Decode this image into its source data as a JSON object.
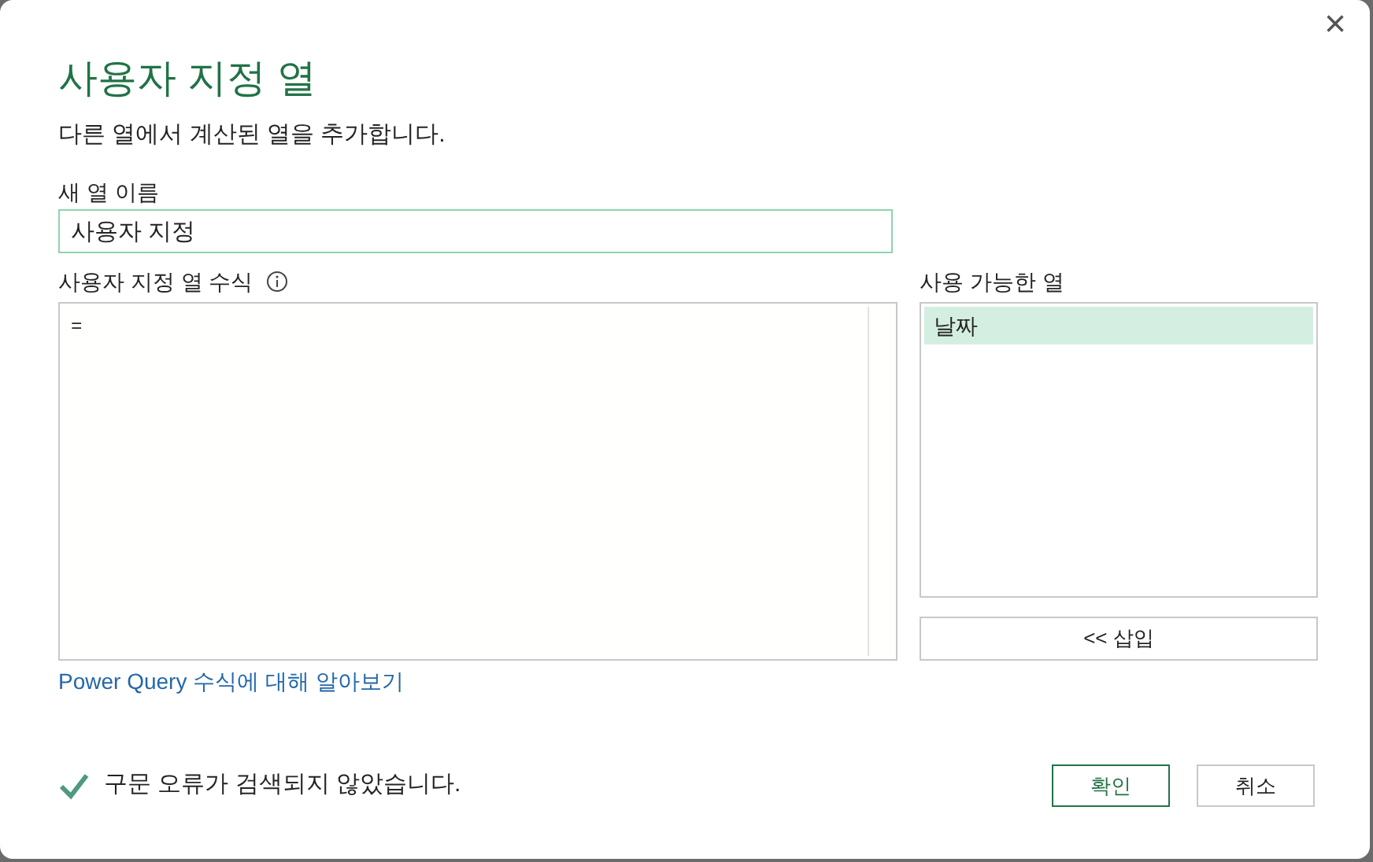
{
  "dialog": {
    "title": "사용자 지정 열",
    "subtitle": "다른 열에서 계산된 열을 추가합니다.",
    "close": "×"
  },
  "name_field": {
    "label": "새 열 이름",
    "value": "사용자 지정"
  },
  "formula": {
    "label": "사용자 지정 열 수식",
    "value": "="
  },
  "available_columns": {
    "label": "사용 가능한 열",
    "items": [
      {
        "label": "날짜",
        "selected": true
      }
    ]
  },
  "insert_button": "<< 삽입",
  "learn_link": "Power Query 수식에 대해 알아보기",
  "status": {
    "ok": true,
    "text": "구문 오류가 검색되지 않았습니다."
  },
  "buttons": [
    {
      "label": "확인",
      "primary": true
    },
    {
      "label": "취소",
      "primary": false
    }
  ]
}
